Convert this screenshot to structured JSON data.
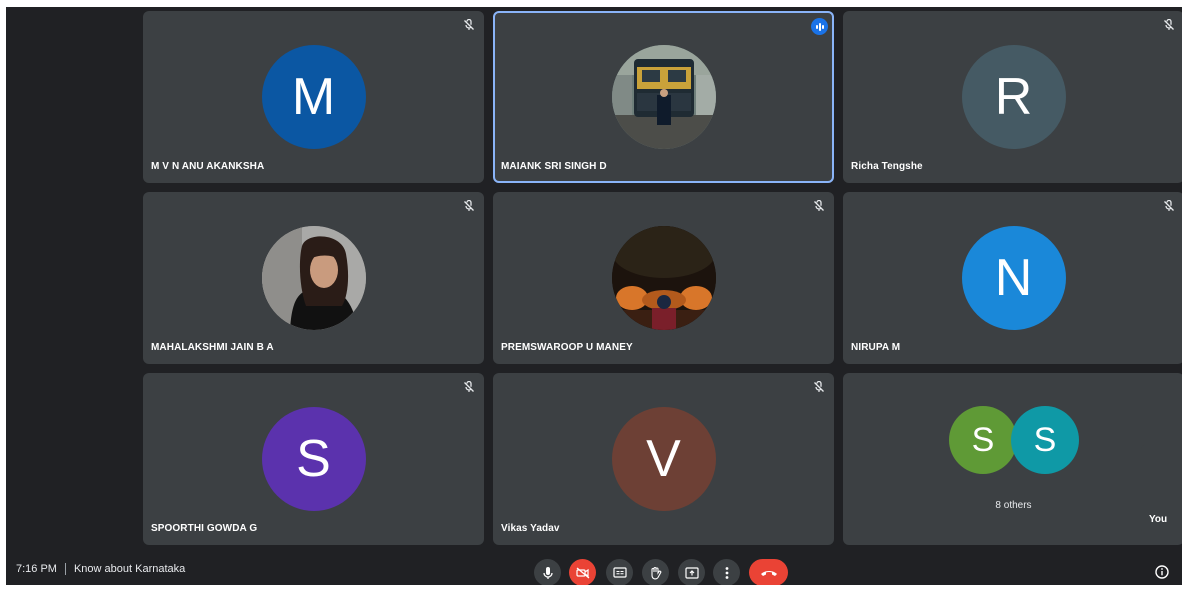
{
  "meeting": {
    "time": "7:16 PM",
    "title": "Know about Karnataka"
  },
  "participants": [
    {
      "name": "M V N ANU AKANKSHA",
      "initial": "M",
      "color": "#0b57a3",
      "muted": true
    },
    {
      "name": "MAIANK SRI SINGH D",
      "photo": "train-photo",
      "speaking": true
    },
    {
      "name": "Richa Tengshe",
      "initial": "R",
      "color": "#455a64",
      "muted": true
    },
    {
      "name": "MAHALAKSHMI JAIN B A",
      "photo": "portrait-photo",
      "muted": true
    },
    {
      "name": "PREMSWAROOP U MANEY",
      "photo": "night-photo",
      "muted": true
    },
    {
      "name": "NIRUPA M",
      "initial": "N",
      "color": "#1a88d9",
      "muted": true
    },
    {
      "name": "SPOORTHI GOWDA G",
      "initial": "S",
      "color": "#5b32ad",
      "muted": true
    },
    {
      "name": "Vikas Yadav",
      "initial": "V",
      "color": "#6d4035",
      "muted": true
    }
  ],
  "others": {
    "label": "8 others",
    "avatars": [
      {
        "initial": "S",
        "color": "#5f9a36"
      },
      {
        "initial": "S",
        "color": "#0f99a6"
      }
    ]
  },
  "self": {
    "label": "You"
  },
  "controls": [
    "mic-icon",
    "camera-off-icon",
    "captions-icon",
    "raise-hand-icon",
    "present-icon",
    "more-options-icon",
    "end-call-icon"
  ],
  "info_icon": "info-icon"
}
